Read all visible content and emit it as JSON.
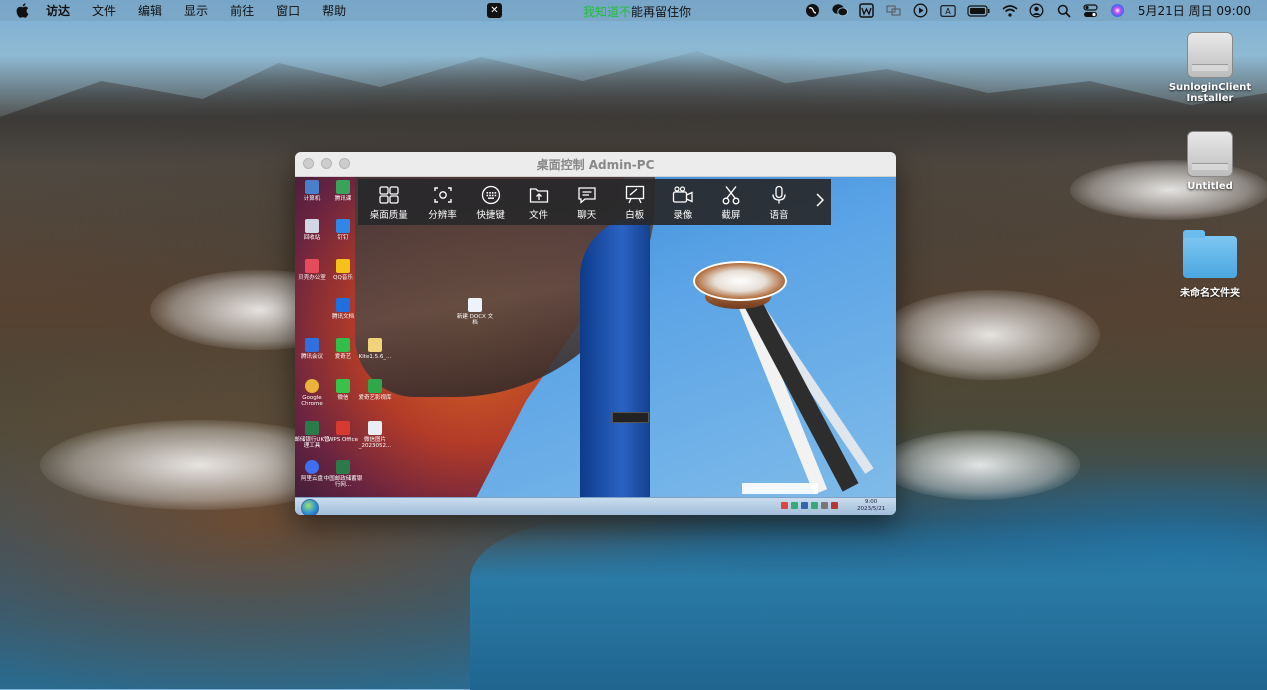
{
  "menubar": {
    "items": [
      "访达",
      "文件",
      "编辑",
      "显示",
      "前往",
      "窗口",
      "帮助"
    ],
    "banner_green": "我知道不",
    "banner_rest": "能再留住你",
    "clock": "5月21日 周日 09:00"
  },
  "desktop": {
    "icons": [
      {
        "label": "SunloginClient Installer",
        "type": "disk"
      },
      {
        "label": "Untitled",
        "type": "disk"
      },
      {
        "label": "未命名文件夹",
        "type": "folder"
      }
    ]
  },
  "remote_window": {
    "title": "桌面控制 Admin-PC",
    "toolbar": [
      {
        "label": "桌面质量",
        "icon": "grid-icon"
      },
      {
        "label": "分辨率",
        "icon": "resolution-icon"
      },
      {
        "label": "快捷键",
        "icon": "keyboard-icon"
      },
      {
        "label": "文件",
        "icon": "file-transfer-icon"
      },
      {
        "label": "聊天",
        "icon": "chat-icon"
      },
      {
        "label": "白板",
        "icon": "whiteboard-icon"
      },
      {
        "label": "录像",
        "icon": "video-record-icon"
      },
      {
        "label": "截屏",
        "icon": "scissors-icon"
      },
      {
        "label": "语音",
        "icon": "microphone-icon"
      }
    ],
    "remote_icons": [
      "计算机",
      "腾讯课",
      "回收站",
      "钉钉",
      "贝壳办公室",
      "QQ音乐",
      "腾讯文档",
      "新建 DOCX 文档",
      "腾讯会议",
      "爱奇艺",
      "Kite1.5.6_...",
      "Google Chrome",
      "微信",
      "爱奇艺影视库",
      "邮储银行UK管理工具",
      "WPS Office",
      "微信图片_2023052...",
      "阿里云盘",
      "中国邮政储蓄银行网..."
    ],
    "taskbar_clock_time": "9:00",
    "taskbar_clock_date": "2023/5/21"
  },
  "colors": {
    "banner_green": "#1fbf3a",
    "toolbar_bg": "#28282a"
  }
}
